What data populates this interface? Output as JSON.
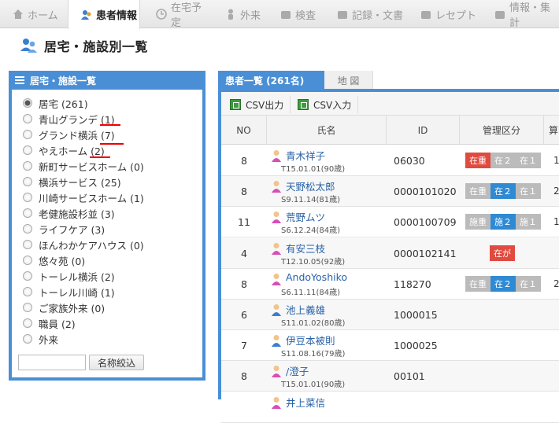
{
  "nav": {
    "items": [
      {
        "label": "ホーム",
        "icon": "home-icon"
      },
      {
        "label": "患者情報",
        "icon": "patient-icon"
      },
      {
        "label": "在宅予定",
        "icon": "clock-icon"
      },
      {
        "label": "外来",
        "icon": "person-icon"
      },
      {
        "label": "検査",
        "icon": "image-icon"
      },
      {
        "label": "記録・文書",
        "icon": "document-icon"
      },
      {
        "label": "レセプト",
        "icon": "folder-icon"
      },
      {
        "label": "情報・集計",
        "icon": "computer-icon"
      }
    ],
    "active": "患者情報"
  },
  "page": {
    "title": "居宅・施設別一覧"
  },
  "left_panel": {
    "header": "居宅・施設一覧",
    "options": [
      {
        "label": "居宅 (261)",
        "checked": true
      },
      {
        "label": "青山グランデ (1)",
        "checked": false
      },
      {
        "label": "グランド横浜 (7)",
        "checked": false
      },
      {
        "label": "やえホーム (2)",
        "checked": false
      },
      {
        "label": "新町サービスホーム (0)",
        "checked": false
      },
      {
        "label": "横浜サービス (25)",
        "checked": false
      },
      {
        "label": "川崎サービスホーム (1)",
        "checked": false
      },
      {
        "label": "老健施設杉並 (3)",
        "checked": false
      },
      {
        "label": "ライフケア (3)",
        "checked": false
      },
      {
        "label": "ほんわかケアハウス (0)",
        "checked": false
      },
      {
        "label": "悠々苑 (0)",
        "checked": false
      },
      {
        "label": "トーレル横浜 (2)",
        "checked": false
      },
      {
        "label": "トーレル川崎 (1)",
        "checked": false
      },
      {
        "label": "ご家族外来 (0)",
        "checked": false
      },
      {
        "label": "職員 (2)",
        "checked": false
      },
      {
        "label": "外来",
        "checked": false
      }
    ],
    "filter_input": {
      "value": "",
      "placeholder": ""
    },
    "filter_button": "名称絞込"
  },
  "right_panel": {
    "tab_active": "患者一覧 (261名)",
    "tab_map": "地 図",
    "toolbar": {
      "csv_out": "CSV出力",
      "csv_in": "CSV入力"
    },
    "columns": [
      "NO",
      "氏名",
      "ID",
      "管理区分",
      "算"
    ],
    "rows": [
      {
        "no": "8",
        "name": "青木祥子",
        "birth": "T15.01.01(90歳)",
        "gender": "female",
        "id": "06030",
        "badges": [
          {
            "t": "在重",
            "c": "red"
          },
          {
            "t": "在２",
            "c": "gray"
          },
          {
            "t": "在１",
            "c": "gray"
          }
        ],
        "extra": "1"
      },
      {
        "no": "8",
        "name": "天野松太郎",
        "birth": "S9.11.14(81歳)",
        "gender": "female",
        "id": "0000101020",
        "badges": [
          {
            "t": "在重",
            "c": "gray"
          },
          {
            "t": "在２",
            "c": "blue"
          },
          {
            "t": "在１",
            "c": "gray"
          }
        ],
        "extra": "2"
      },
      {
        "no": "11",
        "name": "荒野ムツ",
        "birth": "S6.12.24(84歳)",
        "gender": "female",
        "id": "0000100709",
        "badges": [
          {
            "t": "施重",
            "c": "gray"
          },
          {
            "t": "施２",
            "c": "blue"
          },
          {
            "t": "施１",
            "c": "gray"
          }
        ],
        "extra": "1"
      },
      {
        "no": "4",
        "name": "有安三枝",
        "birth": "T12.10.05(92歳)",
        "gender": "female",
        "id": "0000102141",
        "badges": [
          {
            "t": "在が",
            "c": "red"
          }
        ],
        "extra": ""
      },
      {
        "no": "8",
        "name": "AndoYoshiko",
        "birth": "S6.11.11(84歳)",
        "gender": "female",
        "id": "118270",
        "badges": [
          {
            "t": "在重",
            "c": "gray"
          },
          {
            "t": "在２",
            "c": "blue"
          },
          {
            "t": "在１",
            "c": "gray"
          }
        ],
        "extra": "2"
      },
      {
        "no": "6",
        "name": "池上義雄",
        "birth": "S11.01.02(80歳)",
        "gender": "male",
        "id": "1000015",
        "badges": [],
        "extra": ""
      },
      {
        "no": "7",
        "name": "伊豆本被則",
        "birth": "S11.08.16(79歳)",
        "gender": "male",
        "id": "1000025",
        "badges": [],
        "extra": ""
      },
      {
        "no": "8",
        "name": "/澄子",
        "birth": "T15.01.01(90歳)",
        "gender": "female",
        "id": "00101",
        "badges": [],
        "extra": ""
      },
      {
        "no": "",
        "name": "井上菜信",
        "birth": "",
        "gender": "female",
        "id": "",
        "badges": [],
        "extra": ""
      }
    ]
  },
  "colors": {
    "accent": "#4a8fd6",
    "red": "#e04a3f",
    "blue": "#2f8ad4",
    "gray": "#bbbbbb"
  }
}
